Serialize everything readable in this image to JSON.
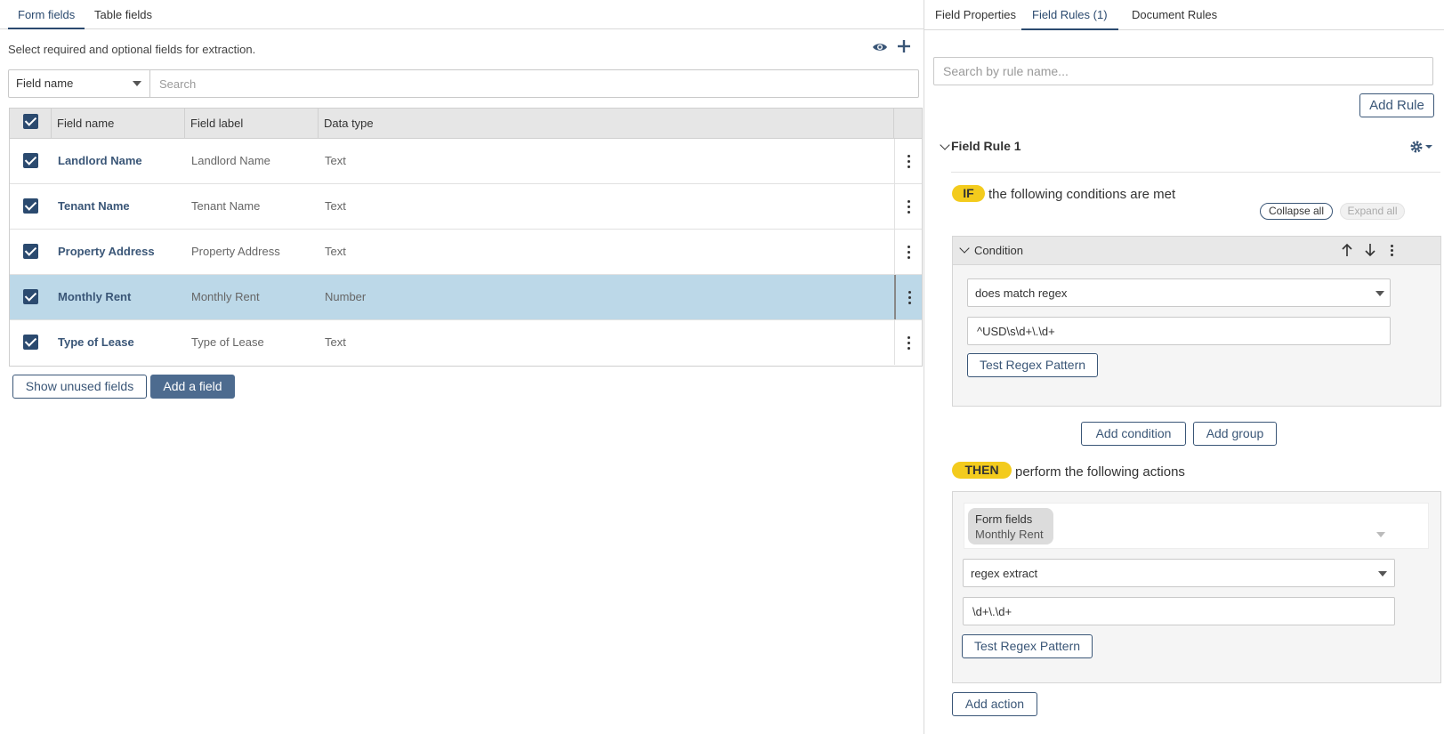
{
  "left": {
    "tabs": [
      {
        "label": "Form fields"
      },
      {
        "label": "Table fields"
      }
    ],
    "hint": "Select required and optional fields for extraction.",
    "filter": {
      "select_value": "Field name",
      "search_placeholder": "Search"
    },
    "table": {
      "columns": [
        "Field name",
        "Field label",
        "Data type"
      ],
      "rows": [
        {
          "name": "Landlord Name",
          "label": "Landlord Name",
          "type": "Text",
          "checked": true,
          "selected": false
        },
        {
          "name": "Tenant Name",
          "label": "Tenant Name",
          "type": "Text",
          "checked": true,
          "selected": false
        },
        {
          "name": "Property Address",
          "label": "Property Address",
          "type": "Text",
          "checked": true,
          "selected": false
        },
        {
          "name": "Monthly Rent",
          "label": "Monthly Rent",
          "type": "Number",
          "checked": true,
          "selected": true
        },
        {
          "name": "Type of Lease",
          "label": "Type of Lease",
          "type": "Text",
          "checked": true,
          "selected": false
        }
      ]
    },
    "buttons": {
      "show_unused": "Show unused fields",
      "add_field": "Add a field"
    }
  },
  "right": {
    "tabs": [
      {
        "label": "Field Properties"
      },
      {
        "label": "Field Rules (1)"
      },
      {
        "label": "Document Rules"
      }
    ],
    "search_placeholder": "Search by rule name...",
    "add_rule": "Add Rule",
    "rule": {
      "title": "Field Rule 1",
      "if_pill": "IF",
      "if_text": "the following conditions are met",
      "collapse_all": "Collapse all",
      "expand_all": "Expand all",
      "condition": {
        "title": "Condition",
        "operator": "does match regex",
        "pattern": "^USD\\s\\d+\\.\\d+",
        "test_btn": "Test Regex Pattern"
      },
      "add_condition": "Add condition",
      "add_group": "Add group",
      "then_pill": "THEN",
      "then_text": "perform the following actions",
      "action": {
        "target_line1": "Form fields",
        "target_line2": "Monthly Rent",
        "operation": "regex extract",
        "pattern": "\\d+\\.\\d+",
        "test_btn": "Test Regex Pattern"
      },
      "add_action": "Add action"
    }
  },
  "colors": {
    "accent": "#2b4a6f",
    "selected_row": "#bcd8e8",
    "pill_yellow": "#f3cb1d",
    "primary_button": "#4d6b8f"
  },
  "icons": [
    "eye-icon",
    "plus-icon",
    "checkbox-icon",
    "kebab-icon",
    "chevron-down-icon",
    "gear-icon",
    "arrow-up-icon",
    "arrow-down-icon",
    "caret-down-icon"
  ]
}
